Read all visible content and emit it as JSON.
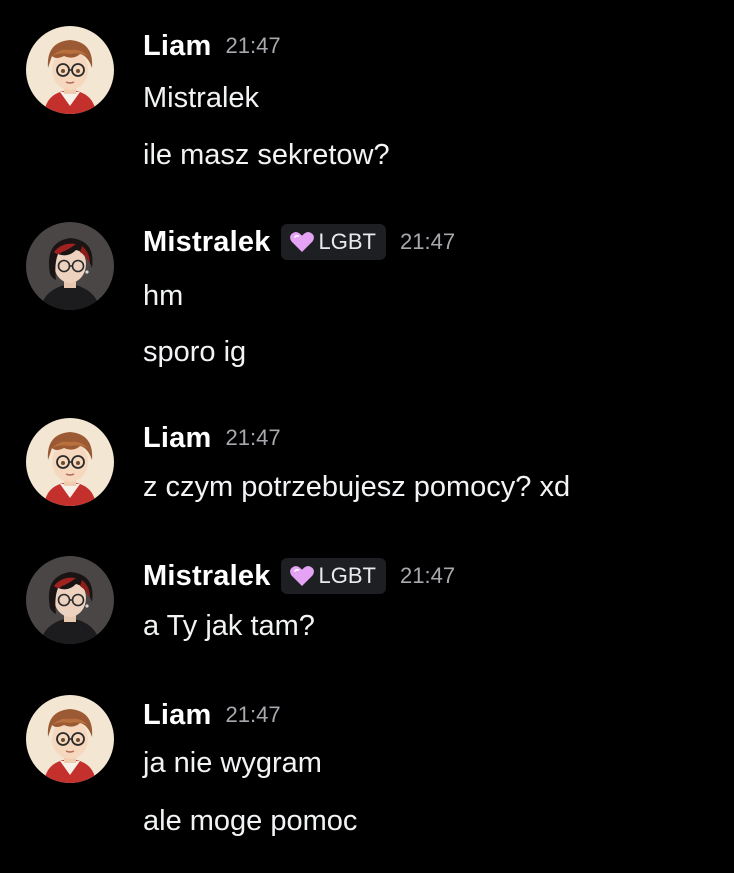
{
  "messages": [
    {
      "author": "Liam",
      "avatar": "liam-avatar",
      "time": "21:47",
      "lines": [
        "Mistralek",
        "ile masz sekretow?"
      ]
    },
    {
      "author": "Mistralek",
      "avatar": "mistralek-avatar",
      "tag": "LGBT",
      "tag_icon": "pink-heart-icon",
      "time": "21:47",
      "lines": [
        "hm",
        "sporo ig"
      ]
    },
    {
      "author": "Liam",
      "avatar": "liam-avatar",
      "time": "21:47",
      "lines": [
        "z czym potrzebujesz pomocy? xd"
      ]
    },
    {
      "author": "Mistralek",
      "avatar": "mistralek-avatar",
      "tag": "LGBT",
      "tag_icon": "pink-heart-icon",
      "time": "21:47",
      "lines": [
        "a Ty jak tam?"
      ]
    },
    {
      "author": "Liam",
      "avatar": "liam-avatar",
      "time": "21:47",
      "lines": [
        "ja nie wygram",
        "ale moge pomoc"
      ]
    }
  ],
  "colors": {
    "background": "#000000",
    "username": "#ffffff",
    "timestamp": "#a7a9ae",
    "message_text": "#f2f3f5",
    "tag_background": "#1e1f22",
    "heart": "#e4a3f5"
  }
}
